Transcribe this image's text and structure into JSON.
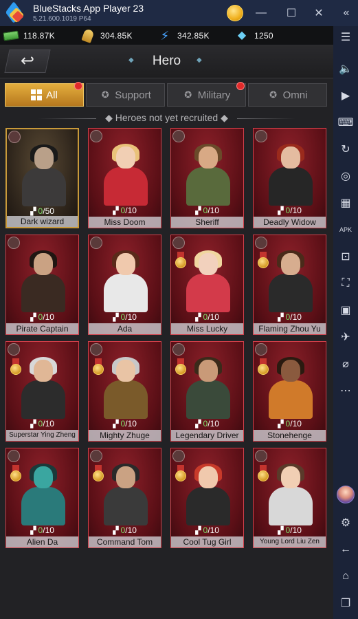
{
  "window": {
    "title": "BlueStacks App Player 23",
    "version": "5.21.600.1019  P64"
  },
  "resources": {
    "cash": "118.87K",
    "wheat": "304.85K",
    "energy": "342.85K",
    "gems": "1250"
  },
  "header": {
    "title": "Hero",
    "back_icon": "↩"
  },
  "tabs": [
    {
      "label": "All",
      "active": true,
      "badge": true
    },
    {
      "label": "Support",
      "active": false,
      "badge": false
    },
    {
      "label": "Military",
      "active": false,
      "badge": true
    },
    {
      "label": "Omni",
      "active": false,
      "badge": false
    }
  ],
  "section_title": "Heroes not yet recruited",
  "heroes": [
    {
      "name": "Dark wizard",
      "current": "0",
      "total": "/50"
    },
    {
      "name": "Miss Doom",
      "current": "0",
      "total": "/10"
    },
    {
      "name": "Sheriff",
      "current": "0",
      "total": "/10"
    },
    {
      "name": "Deadly Widow",
      "current": "0",
      "total": "/10"
    },
    {
      "name": "Pirate Captain",
      "current": "0",
      "total": "/10"
    },
    {
      "name": "Ada",
      "current": "0",
      "total": "/10"
    },
    {
      "name": "Miss Lucky",
      "current": "0",
      "total": "/10"
    },
    {
      "name": "Flaming Zhou Yu",
      "current": "0",
      "total": "/10"
    },
    {
      "name": "Superstar Ying Zheng",
      "current": "0",
      "total": "/10"
    },
    {
      "name": "Mighty Zhuge",
      "current": "0",
      "total": "/10"
    },
    {
      "name": "Legendary Driver",
      "current": "0",
      "total": "/10"
    },
    {
      "name": "Stonehenge",
      "current": "0",
      "total": "/10"
    },
    {
      "name": "Alien Da",
      "current": "0",
      "total": "/10"
    },
    {
      "name": "Command Tom",
      "current": "0",
      "total": "/10"
    },
    {
      "name": "Cool Tug Girl",
      "current": "0",
      "total": "/10"
    },
    {
      "name": "Young Lord Liu Zen",
      "current": "0",
      "total": "/10"
    }
  ],
  "colors": {
    "tab_active": "#e4ae3e",
    "card_border": "#d2404a",
    "progress_current": "#7fe06b",
    "badge": "#e12a2a"
  }
}
